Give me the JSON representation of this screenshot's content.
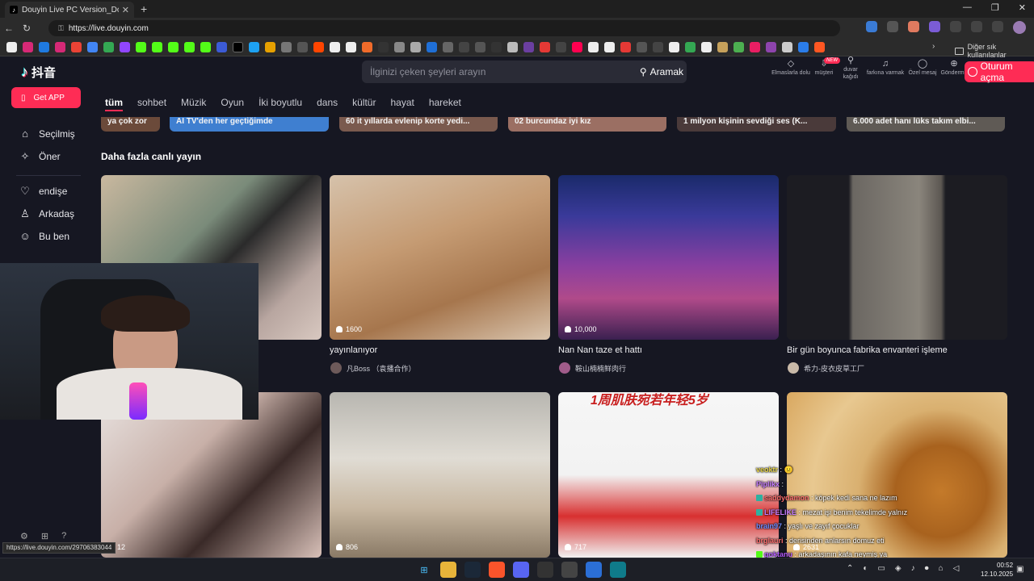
{
  "browser": {
    "tab_title": "Douyin Live PC Version_Douyin L",
    "tab_close": "✕",
    "new_tab": "+",
    "url": "https://live.douyin.com",
    "bookmark_more": "›",
    "other_bookmarks": "Diğer sık kullanılanlar",
    "window_controls": [
      "—",
      "❐",
      "✕"
    ]
  },
  "header": {
    "logo_text": "抖音",
    "search_placeholder": "İlginizi çeken şeyleri arayın",
    "search_button": "Aramak",
    "icons": [
      {
        "name": "diamond-icon",
        "glyph": "◇",
        "label": "Elmaslarla dolu"
      },
      {
        "name": "customer-icon",
        "glyph": "⇩",
        "label": "müşteri"
      },
      {
        "name": "wallpaper-icon",
        "glyph": "⚲",
        "label": "duvar kağıdı"
      },
      {
        "name": "notification-icon",
        "glyph": "🔔︎",
        "label": "farkına varmak"
      },
      {
        "name": "message-icon",
        "glyph": "◯",
        "label": "Özel mesaj"
      },
      {
        "name": "submit-icon",
        "glyph": "⊕",
        "label": "Gönderme"
      }
    ],
    "new_badge": "NEW",
    "login_button": "Oturum açma"
  },
  "sidebar": {
    "get_app": "Get APP",
    "items": [
      {
        "label": "Seçilmiş",
        "icon": "⌂"
      },
      {
        "label": "Öner",
        "icon": "✧"
      },
      {
        "label": "endişe",
        "icon": "♡"
      },
      {
        "label": "Arkadaş",
        "icon": "♙"
      },
      {
        "label": "Bu ben",
        "icon": "☺"
      }
    ]
  },
  "categories": [
    "tüm",
    "sohbet",
    "Müzik",
    "Oyun",
    "İki boyutlu",
    "dans",
    "kültür",
    "hayat",
    "hareket"
  ],
  "top_cards": [
    "ya çok zor",
    "AI TV'den her geçtiğimde",
    "60 it yıllarda evlenip korte yedi...",
    "02 burcundaz iyi kız",
    "1 milyon kişinin sevdiği ses (K...",
    "6.000 adet hanı lüks takım elbi..."
  ],
  "section_title": "Daha fazla canlı yayın",
  "cards_row1": [
    {
      "viewers": "",
      "title": "",
      "author": ""
    },
    {
      "viewers": "1600",
      "title": "yayınlanıyor",
      "author": "凡Boss （袁播合作）"
    },
    {
      "viewers": "10,000",
      "title": "Nan Nan taze et hattı",
      "author": "鞍山楠楠鲜肉行"
    },
    {
      "viewers": "",
      "title": "Bir gün boyunca fabrika envanteri işleme",
      "author": "希力-皮衣皮草工厂"
    }
  ],
  "cards_row2": [
    {
      "viewers": "12"
    },
    {
      "viewers": "806"
    },
    {
      "viewers": "717",
      "banner": "1周肌肤宛若年轻5岁"
    },
    {
      "viewers": "2631"
    }
  ],
  "chat": [
    {
      "name": "veoktr",
      "color": "#e8d54a",
      "msg": ": 😐"
    },
    {
      "name": "Piplikx",
      "color": "#c77dff",
      "msg": ": "
    },
    {
      "name": "saddydamon",
      "color": "#ff7070",
      "msg": ": köpek kedi sana ne lazım",
      "badge": true
    },
    {
      "name": "LIFELIKE",
      "color": "#c77dff",
      "msg": ": mezat işi benim tekelimde yalnız",
      "badge": true
    },
    {
      "name": "brain97",
      "color": "#6f8cff",
      "msg": ": yaşlı ve zayıf çocuklar"
    },
    {
      "name": "brglauri",
      "color": "#ff7070",
      "msg": ": derisinden anlarsın domuz eti"
    },
    {
      "name": "goktanu",
      "color": "#b55cff",
      "msg": ": arkadaşının kafa neymiş ya",
      "badge": true
    }
  ],
  "status_url": "https://live.douyin.com/29706383044",
  "taskbar": {
    "time": "00:52",
    "date": "12.10.2025"
  },
  "colors": {
    "accent": "#fe2c55",
    "page_bg": "#161722"
  }
}
